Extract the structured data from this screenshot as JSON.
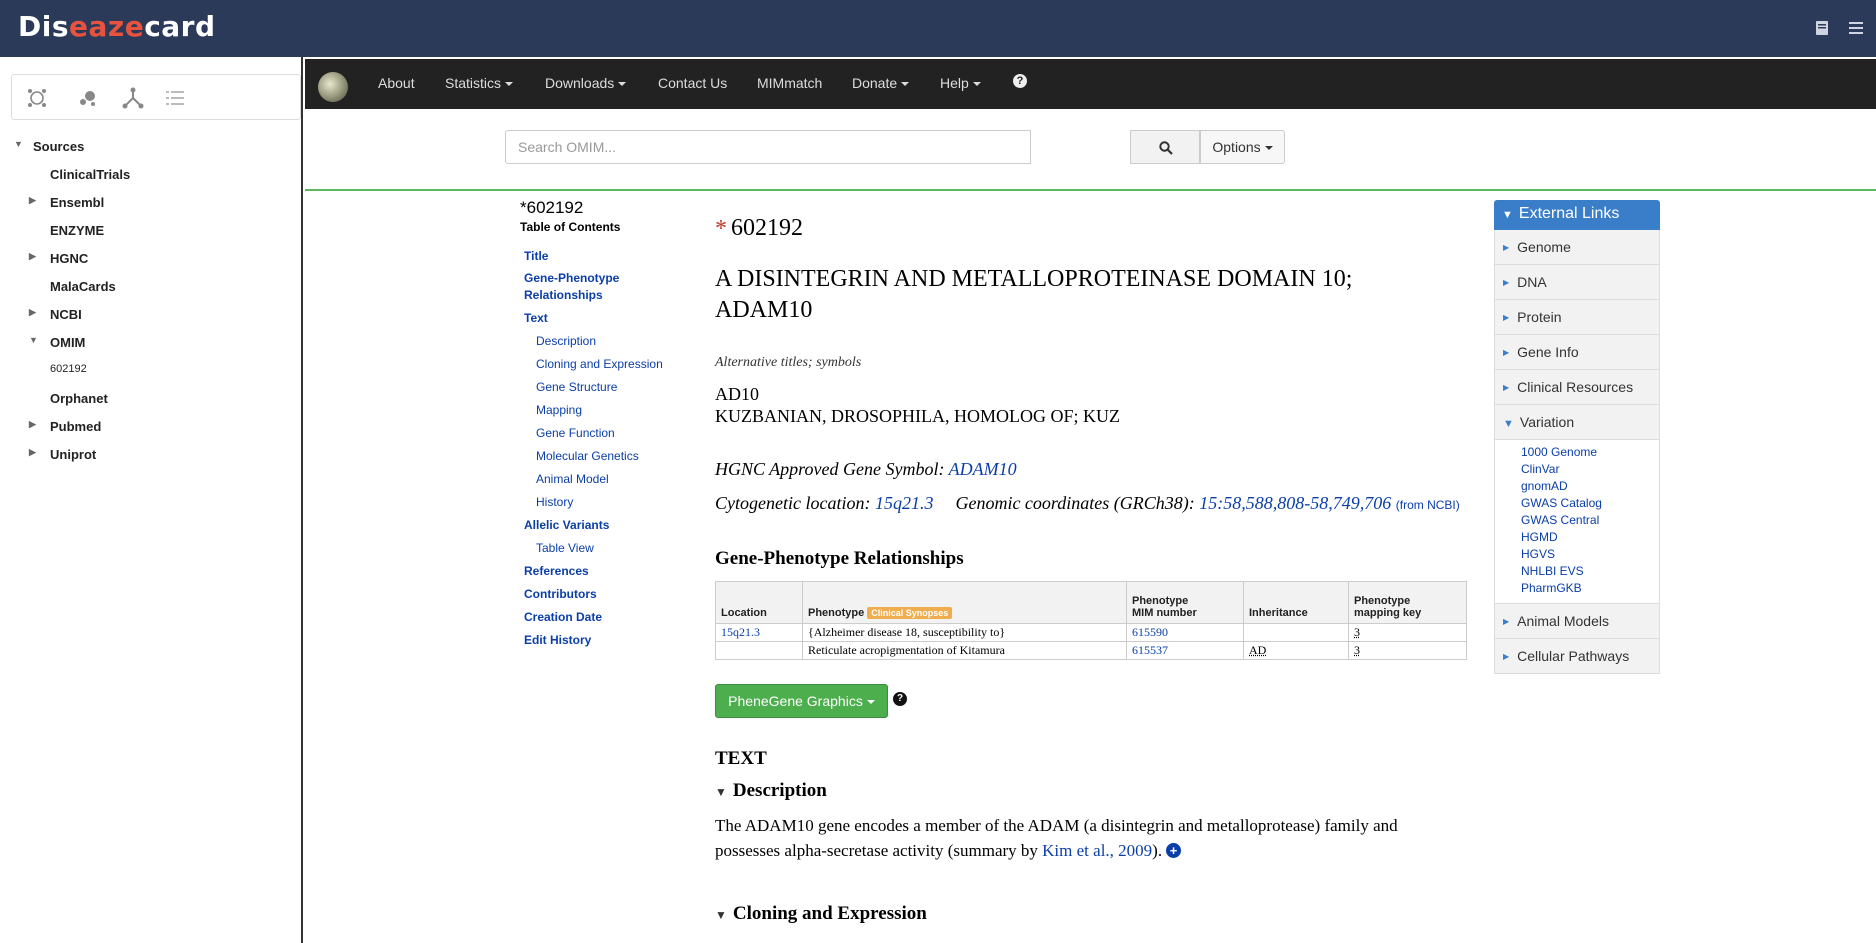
{
  "app": {
    "logo_pre": "Dis",
    "logo_mid": "eaze",
    "logo_post": "card"
  },
  "sidebar": {
    "tools": [
      "network-icon",
      "bubbles-icon",
      "hierarchy-icon",
      "list-icon"
    ],
    "root_label": "Sources",
    "items": [
      {
        "label": "ClinicalTrials",
        "expandable": false
      },
      {
        "label": "Ensembl",
        "expandable": true
      },
      {
        "label": "ENZYME",
        "expandable": false
      },
      {
        "label": "HGNC",
        "expandable": true
      },
      {
        "label": "MalaCards",
        "expandable": false
      },
      {
        "label": "NCBI",
        "expandable": true
      },
      {
        "label": "OMIM",
        "expandable": true,
        "expanded": true
      },
      {
        "label": "602192",
        "child": true
      },
      {
        "label": "Orphanet",
        "expandable": false
      },
      {
        "label": "Pubmed",
        "expandable": true
      },
      {
        "label": "Uniprot",
        "expandable": true
      }
    ]
  },
  "navbar": {
    "about": "About",
    "statistics": "Statistics",
    "downloads": "Downloads",
    "contact": "Contact Us",
    "mimmatch": "MIMmatch",
    "donate": "Donate",
    "help": "Help",
    "help_icon": "?"
  },
  "search": {
    "placeholder": "Search OMIM...",
    "options_label": "Options"
  },
  "toc": {
    "entry_id": "*602192",
    "title": "Table of Contents",
    "links": {
      "title": "Title",
      "gpr1": "Gene-Phenotype",
      "gpr2": "Relationships",
      "text": "Text",
      "description": "Description",
      "cloning": "Cloning and Expression",
      "structure": "Gene Structure",
      "mapping": "Mapping",
      "function": "Gene Function",
      "molgen": "Molecular Genetics",
      "animal": "Animal Model",
      "history": "History",
      "allelic": "Allelic Variants",
      "tableview": "Table View",
      "references": "References",
      "contributors": "Contributors",
      "creation": "Creation Date",
      "edithistory": "Edit History"
    }
  },
  "entry": {
    "star": "*",
    "mim_number": "602192",
    "title_line1": "A DISINTEGRIN AND METALLOPROTEINASE DOMAIN 10;",
    "title_line2": "ADAM10",
    "alt_label": "Alternative titles; symbols",
    "alt_symbols": [
      "AD10",
      "KUZBANIAN, DROSOPHILA, HOMOLOG OF; KUZ"
    ],
    "hgnc_label": "HGNC Approved Gene Symbol: ",
    "hgnc_symbol": "ADAM10",
    "cyto_label": "Cytogenetic location: ",
    "cyto_value": "15q21.3",
    "genomic_label": "Genomic coordinates (GRCh38): ",
    "genomic_value": "15:58,588,808-58,749,706",
    "genomic_source": "(from NCBI)"
  },
  "gpr": {
    "heading": "Gene-Phenotype Relationships",
    "headers": {
      "location": "Location",
      "phenotype": "Phenotype",
      "badge": "Clinical Synopses",
      "mim1": "Phenotype",
      "mim2": "MIM number",
      "inheritance": "Inheritance",
      "key1": "Phenotype",
      "key2": "mapping key"
    },
    "rows": [
      {
        "location": "15q21.3",
        "phenotype": "{Alzheimer disease 18, susceptibility to}",
        "mim": "615590",
        "inheritance": "",
        "key": "3"
      },
      {
        "location": "",
        "phenotype": "Reticulate acropigmentation of Kitamura",
        "mim": "615537",
        "inheritance": "AD",
        "key": "3"
      }
    ]
  },
  "phenegene": {
    "label": "PheneGene Graphics",
    "help": "?"
  },
  "text_section": {
    "heading": "TEXT",
    "desc_heading": "Description",
    "desc_part1": "The ADAM10 gene encodes a member of the ADAM (a disintegrin and metalloprotease) family and possesses alpha-secretase activity (summary by ",
    "desc_link": "Kim et al., 2009",
    "desc_part2": ").",
    "plus": "+",
    "cloning_heading": "Cloning and Expression"
  },
  "external": {
    "heading": "External Links",
    "items": [
      "Genome",
      "DNA",
      "Protein",
      "Gene Info",
      "Clinical Resources"
    ],
    "variation": "Variation",
    "variation_links": [
      "1000 Genome",
      "ClinVar",
      "gnomAD",
      "GWAS Catalog",
      "GWAS Central",
      "HGMD",
      "HGVS",
      "NHLBI EVS",
      "PharmGKB"
    ],
    "after": [
      "Animal Models",
      "Cellular Pathways"
    ]
  },
  "colors": {
    "appbar": "#2c3a5a",
    "logo_accent": "#e8533f",
    "navbar": "#222222",
    "link": "#0a3ea8",
    "green": "#4cae4c",
    "external_head": "#3a7dc8",
    "badge": "#f0ad4e"
  }
}
